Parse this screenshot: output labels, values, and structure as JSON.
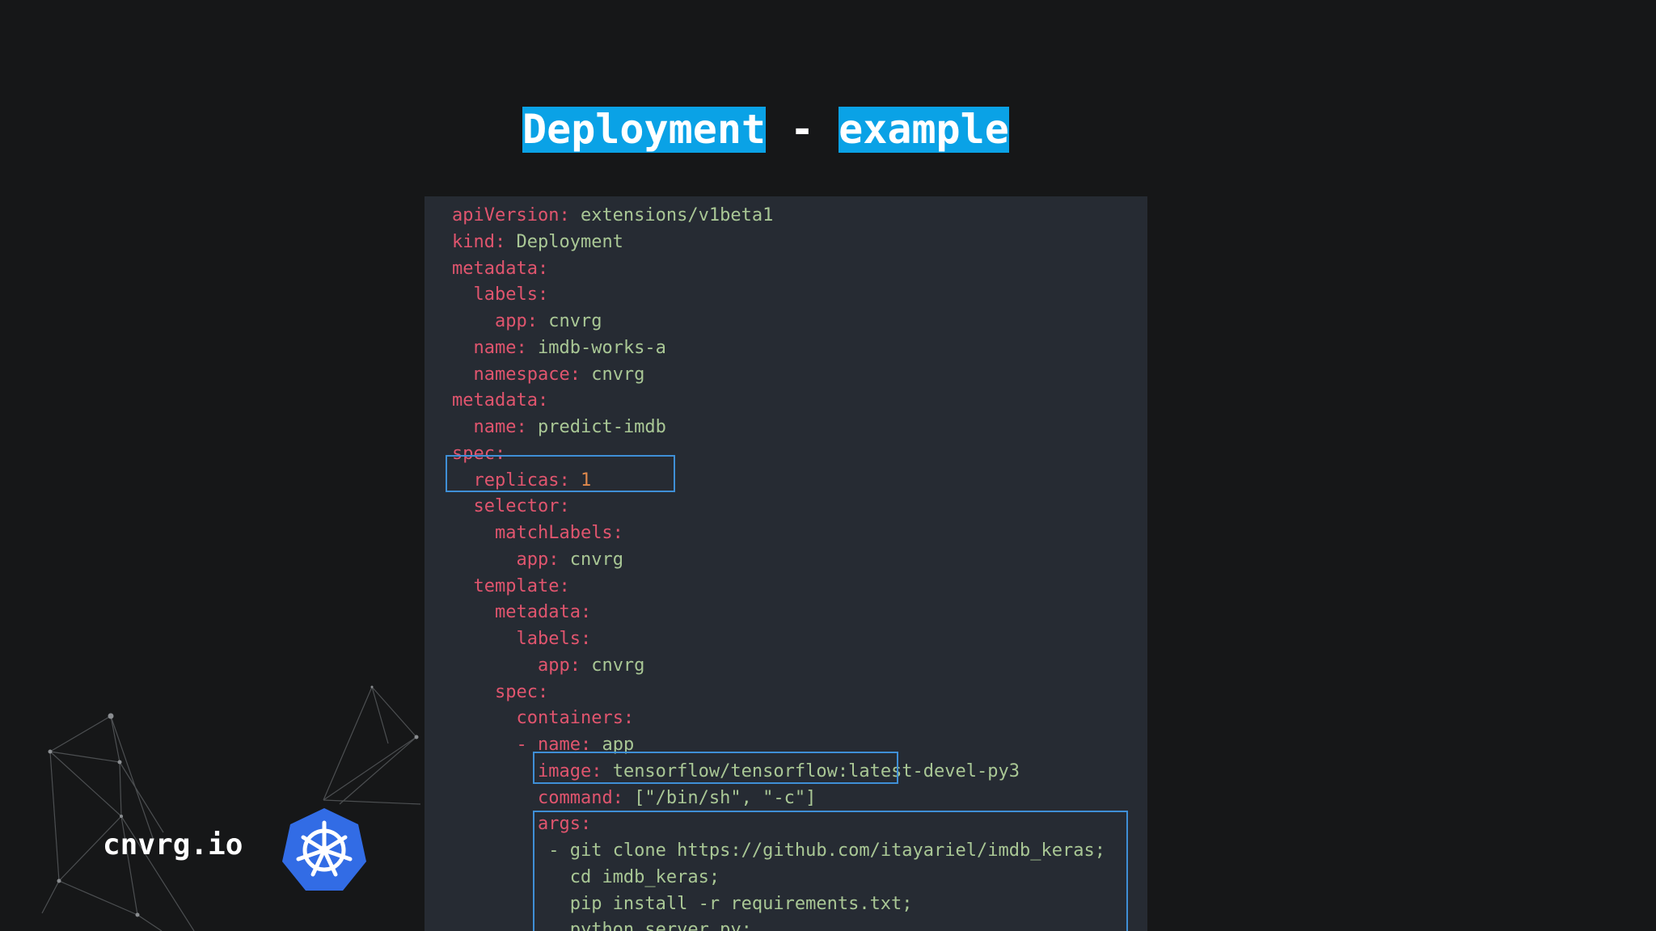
{
  "title": {
    "left": "Deployment",
    "dash": "-",
    "right": "example"
  },
  "brand": {
    "name": "cnvrg.io",
    "logo_icon": "kubernetes-helm-wheel-icon",
    "logo_color": "#326ce5"
  },
  "code": {
    "lines": [
      {
        "indent": "",
        "key": "apiVersion:",
        "value": " extensions/v1beta1"
      },
      {
        "indent": "",
        "key": "kind:",
        "value": " Deployment"
      },
      {
        "indent": "",
        "key": "metadata:",
        "value": ""
      },
      {
        "indent": "  ",
        "key": "labels:",
        "value": ""
      },
      {
        "indent": "    ",
        "key": "app:",
        "value": " cnvrg"
      },
      {
        "indent": "  ",
        "key": "name:",
        "value": " imdb-works-a"
      },
      {
        "indent": "  ",
        "key": "namespace:",
        "value": " cnvrg"
      },
      {
        "indent": "",
        "key": "metadata:",
        "value": ""
      },
      {
        "indent": "  ",
        "key": "name:",
        "value": " predict-imdb"
      },
      {
        "indent": "",
        "key": "spec:",
        "value": ""
      },
      {
        "indent": "  ",
        "key": "replicas:",
        "value": " 1"
      },
      {
        "indent": "  ",
        "key": "selector:",
        "value": ""
      },
      {
        "indent": "    ",
        "key": "matchLabels:",
        "value": ""
      },
      {
        "indent": "      ",
        "key": "app:",
        "value": " cnvrg"
      },
      {
        "indent": "  ",
        "key": "template:",
        "value": ""
      },
      {
        "indent": "    ",
        "key": "metadata:",
        "value": ""
      },
      {
        "indent": "      ",
        "key": "labels:",
        "value": ""
      },
      {
        "indent": "        ",
        "key": "app:",
        "value": " cnvrg"
      },
      {
        "indent": "    ",
        "key": "spec:",
        "value": ""
      },
      {
        "indent": "      ",
        "key": "containers:",
        "value": ""
      },
      {
        "indent": "      ",
        "key": "- name:",
        "value": " app"
      },
      {
        "indent": "        ",
        "key": "image:",
        "value": " tensorflow/tensorflow:latest-devel-py3"
      },
      {
        "indent": "        ",
        "key": "command:",
        "value": " [\"/bin/sh\", \"-c\"]"
      },
      {
        "indent": "        ",
        "key": "args:",
        "value": ""
      },
      {
        "indent": "         ",
        "key": "",
        "value": "- git clone https://github.com/itayariel/imdb_keras;"
      },
      {
        "indent": "           ",
        "key": "",
        "value": "cd imdb_keras;"
      },
      {
        "indent": "           ",
        "key": "",
        "value": "pip install -r requirements.txt;"
      },
      {
        "indent": "           ",
        "key": "",
        "value": "python server.py;"
      }
    ],
    "colors": {
      "key": "#e0556e",
      "value": "#a9c795",
      "number": "#e0894c",
      "panel_bg": "#262b33",
      "highlight_border": "#3f8fd6"
    }
  }
}
